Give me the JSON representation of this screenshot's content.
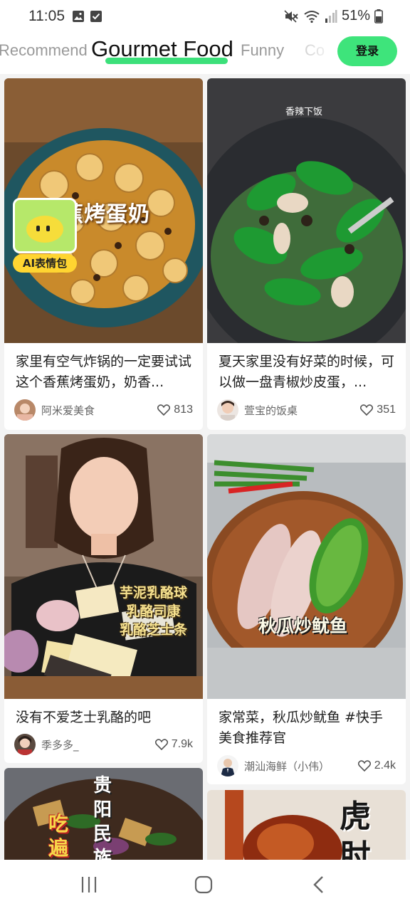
{
  "status_bar": {
    "time": "11:05",
    "battery": "51%",
    "icons": [
      "gallery-icon",
      "check-icon",
      "mute-icon",
      "wifi-icon",
      "signal-icon",
      "battery-icon"
    ]
  },
  "tabs": [
    {
      "label": "Recommend",
      "active": false
    },
    {
      "label": "Gourmet Food",
      "active": true
    },
    {
      "label": "Funny",
      "active": false
    },
    {
      "label": "Co",
      "active": false
    }
  ],
  "login_label": "登录",
  "accent_color": "#3ee47b",
  "feed": [
    {
      "thumb_text": "香蕉烤蛋奶",
      "badge": "AI表情包",
      "title": "家里有空气炸锅的一定要试试这个香蕉烤蛋奶，奶香...",
      "author": "阿米爱美食",
      "likes": "813"
    },
    {
      "thumb_text": "香辣下饭",
      "title": "夏天家里没有好菜的时候，可以做一盘青椒炒皮蛋，...",
      "author": "萱宝的饭桌",
      "likes": "351"
    },
    {
      "thumb_text_lines": [
        "芋泥乳酪球",
        "乳酪司康",
        "乳酪芝士条"
      ],
      "title": "没有不爱芝士乳酪的吧",
      "author": "季多多_",
      "likes": "7.9k"
    },
    {
      "thumb_text": "秋瓜炒鱿鱼",
      "title": "家常菜，秋瓜炒鱿鱼 #快手美食推荐官",
      "author": "潮汕海鲜（小伟）",
      "likes": "2.4k"
    },
    {
      "thumb_text_lines": [
        "贵",
        "阳",
        "民",
        "族"
      ],
      "thumb_text_side": [
        "吃",
        "遍"
      ]
    },
    {
      "thumb_text_lines": [
        "虎",
        "肘"
      ]
    }
  ],
  "nav": [
    "recents-button",
    "home-button",
    "back-button"
  ]
}
